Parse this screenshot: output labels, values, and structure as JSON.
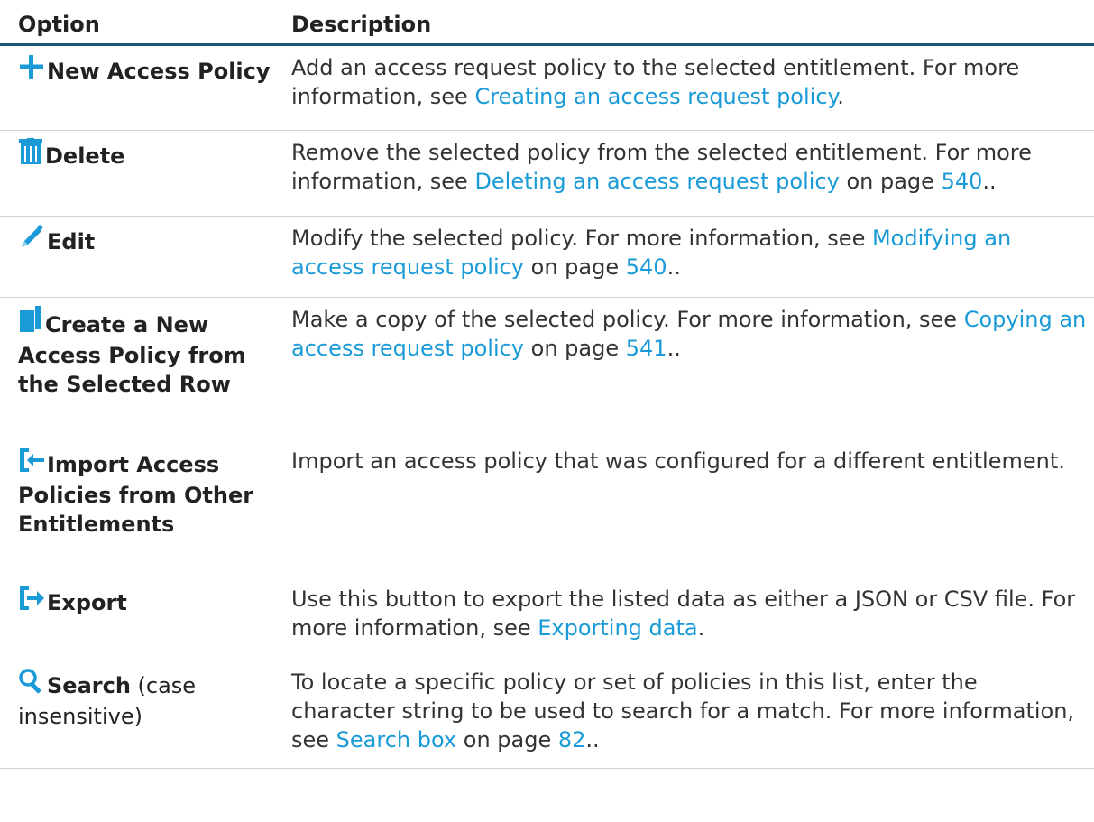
{
  "header": {
    "option": "Option",
    "description": "Description"
  },
  "colors": {
    "accent": "#1a9bd7",
    "rule": "#1a5a73"
  },
  "rows": [
    {
      "icon": "plus-icon",
      "option": "New Access Policy",
      "desc": {
        "t1": "Add an access request policy to the selected entitlement. For more information, see ",
        "l1": "Creating an access request policy",
        "t2": "."
      }
    },
    {
      "icon": "trash-icon",
      "option": "Delete",
      "desc": {
        "t1": "Remove the selected policy from the selected entitlement. For more information, see ",
        "l1": "Deleting an access request policy",
        "t2": " on page ",
        "l2": "540",
        "t3": ".."
      }
    },
    {
      "icon": "pencil-icon",
      "option": "Edit",
      "desc": {
        "t1": "Modify the selected policy. For more information, see ",
        "l1": "Modifying an access request policy",
        "t2": " on page ",
        "l2": "540",
        "t3": ".."
      }
    },
    {
      "icon": "copy-icon",
      "option": "Create a New Access Policy from the Selected Row",
      "desc": {
        "t1": "Make a copy of the selected policy. For more information, see ",
        "l1": "Copying an access request policy",
        "t2": " on page ",
        "l2": "541",
        "t3": ".."
      }
    },
    {
      "icon": "import-icon",
      "option": "Import Access Policies from Other Entitlements",
      "desc": {
        "t1": "Import an access policy that was configured for a different entitlement."
      }
    },
    {
      "icon": "export-icon",
      "option": "Export",
      "desc": {
        "t1": "Use this button to export the listed data as either a JSON or CSV file. For more information, see ",
        "l1": "Exporting data",
        "t2": "."
      }
    },
    {
      "icon": "search-icon",
      "option": "Search",
      "option_suffix": " (case insensitive)",
      "desc": {
        "t1": "To locate a specific policy or set of policies in this list, enter the character string to be used to search for a match. For more information, see ",
        "l1": "Search box",
        "t2": " on page ",
        "l2": "82",
        "t3": ".."
      }
    }
  ]
}
